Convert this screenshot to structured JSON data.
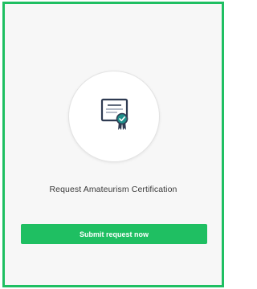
{
  "card": {
    "title": "Request Amateurism Certification",
    "button_label": "Submit request now"
  },
  "icon": {
    "name": "certificate-icon"
  },
  "colors": {
    "accent": "#1fbf62",
    "card_background": "#f7f7f7",
    "icon_stroke": "#2f3b52",
    "badge": "#1f8f8a"
  }
}
